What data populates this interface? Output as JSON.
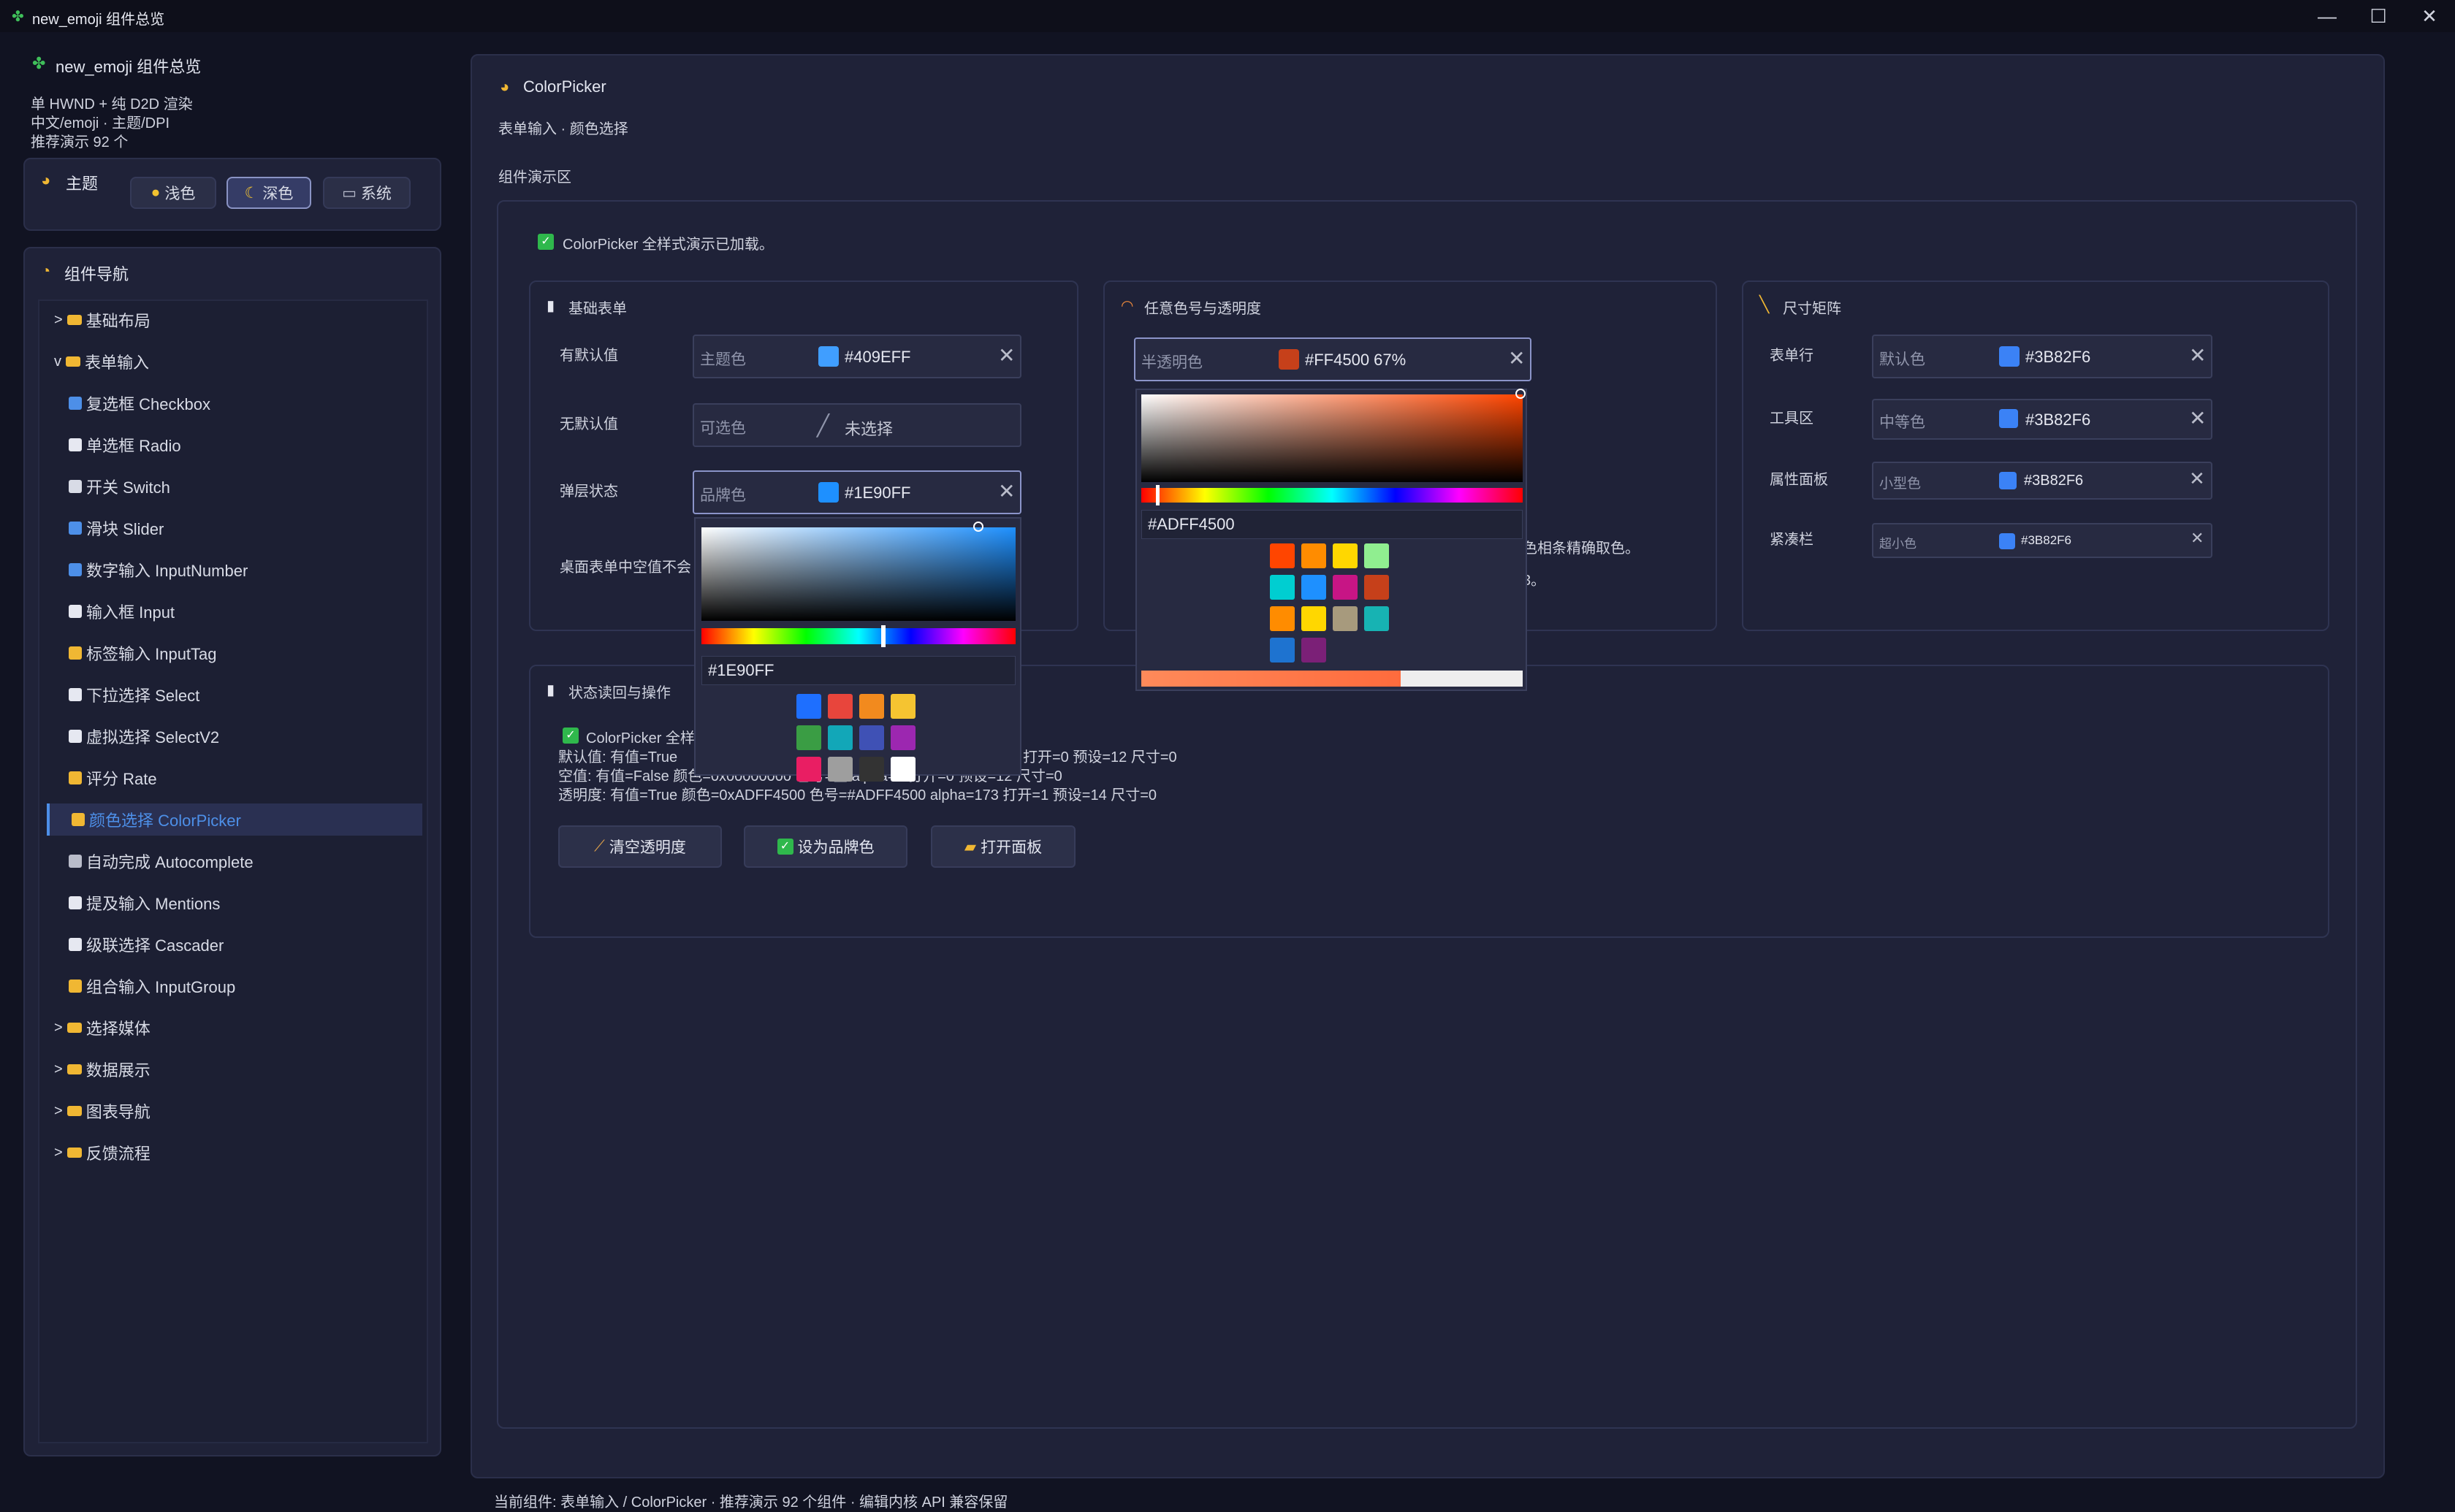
{
  "window": {
    "title": "new_emoji 组件总览",
    "controls": [
      "—",
      "☐",
      "✕"
    ]
  },
  "sidebar": {
    "app_title": "new_emoji 组件总览",
    "info_lines": [
      "单 HWND + 纯 D2D 渲染",
      "中文/emoji · 主题/DPI",
      "推荐演示 92 个"
    ],
    "theme": {
      "label": "主题",
      "buttons": [
        {
          "label": "浅色",
          "active": false
        },
        {
          "label": "深色",
          "active": true
        },
        {
          "label": "系统",
          "active": false
        }
      ]
    },
    "nav_title": "组件导航",
    "nav_items": [
      {
        "prefix": ">",
        "label": "基础布局",
        "kind": "folder"
      },
      {
        "prefix": "v",
        "label": "表单输入",
        "kind": "folder"
      },
      {
        "label": "复选框 Checkbox",
        "kind": "child"
      },
      {
        "label": "单选框 Radio",
        "kind": "child"
      },
      {
        "label": "开关 Switch",
        "kind": "child"
      },
      {
        "label": "滑块 Slider",
        "kind": "child"
      },
      {
        "label": "数字输入 InputNumber",
        "kind": "child"
      },
      {
        "label": "输入框 Input",
        "kind": "child"
      },
      {
        "label": "标签输入 InputTag",
        "kind": "child"
      },
      {
        "label": "下拉选择 Select",
        "kind": "child"
      },
      {
        "label": "虚拟选择 SelectV2",
        "kind": "child"
      },
      {
        "label": "评分 Rate",
        "kind": "child"
      },
      {
        "label": "颜色选择 ColorPicker",
        "kind": "child",
        "active": true
      },
      {
        "label": "自动完成 Autocomplete",
        "kind": "child"
      },
      {
        "label": "提及输入 Mentions",
        "kind": "child"
      },
      {
        "label": "级联选择 Cascader",
        "kind": "child"
      },
      {
        "label": "组合输入 InputGroup",
        "kind": "child"
      },
      {
        "prefix": ">",
        "label": "选择媒体",
        "kind": "folder"
      },
      {
        "prefix": ">",
        "label": "数据展示",
        "kind": "folder"
      },
      {
        "prefix": ">",
        "label": "图表导航",
        "kind": "folder"
      },
      {
        "prefix": ">",
        "label": "反馈流程",
        "kind": "folder"
      }
    ]
  },
  "main": {
    "title": "ColorPicker",
    "subtitle": "表单输入 · 颜色选择",
    "demo_label": "组件演示区",
    "loaded_msg": "ColorPicker 全样式演示已加载。",
    "basic": {
      "title": "基础表单",
      "rows": [
        {
          "label": "有默认值",
          "placeholder": "主题色",
          "value": "#409EFF",
          "color": "#409EFF",
          "clear": "✕"
        },
        {
          "label": "无默认值",
          "placeholder": "可选色",
          "value": "未选择"
        },
        {
          "label": "弹层状态",
          "placeholder": "品牌色",
          "value": "#1E90FF",
          "color": "#1E90FF",
          "clear": "✕"
        }
      ],
      "note": "桌面表单中空值不会"
    },
    "alpha": {
      "title": "任意色号与透明度",
      "placeholder": "半透明色",
      "value": "#FF4500 67%",
      "color": "#C6401A",
      "clear": "✕",
      "note1": "色相条精确取色。",
      "note2": "3。"
    },
    "size": {
      "title": "尺寸矩阵",
      "rows": [
        {
          "label": "表单行",
          "placeholder": "默认色",
          "value": "#3B82F6"
        },
        {
          "label": "工具区",
          "placeholder": "中等色",
          "value": "#3B82F6"
        },
        {
          "label": "属性面板",
          "placeholder": "小型色",
          "value": "#3B82F6"
        },
        {
          "label": "紧凑栏",
          "placeholder": "超小色",
          "value": "#3B82F6"
        }
      ],
      "color": "#3B82F6",
      "clear": "✕"
    },
    "status": {
      "title": "状态读回与操作",
      "check_text": "ColorPicker 全样",
      "lines": [
        "默认值: 有值=True",
        "空值: 有值=False 颜色=0x00000000 色号=空 alpha=0 打开=0 预设=12 尺寸=0",
        "透明度: 有值=True 颜色=0xADFF4500 色号=#ADFF4500 alpha=173 打开=1 预设=14 尺寸=0"
      ],
      "line1_tail": "打开=0 预设=12 尺寸=0",
      "buttons": [
        "清空透明度",
        "设为品牌色",
        "打开面板"
      ]
    },
    "popup1": {
      "hex": "#1E90FF",
      "presets": [
        "#1E6FFF",
        "#E8453C",
        "#F28A1E",
        "#F5C431",
        "#3A9D44",
        "#12A7B8",
        "#3F51B5",
        "#9C27B0",
        "#E91E63",
        "#9E9E9E",
        "#333333",
        "#FFFFFF"
      ]
    },
    "popup2": {
      "hex": "#ADFF4500",
      "presets": [
        "#FF4500",
        "#FF8C00",
        "#FFD700",
        "#90EE90",
        "#00CED1",
        "#1E90FF",
        "#C71585",
        "#C6401A",
        "#FF8C00",
        "#FFD700",
        "#A79A7D",
        "#17B3B3",
        "#1E73D0",
        "#7B2077"
      ]
    },
    "footer": "当前组件: 表单输入 / ColorPicker · 推荐演示 92 个组件 · 编辑内核 API 兼容保留"
  }
}
